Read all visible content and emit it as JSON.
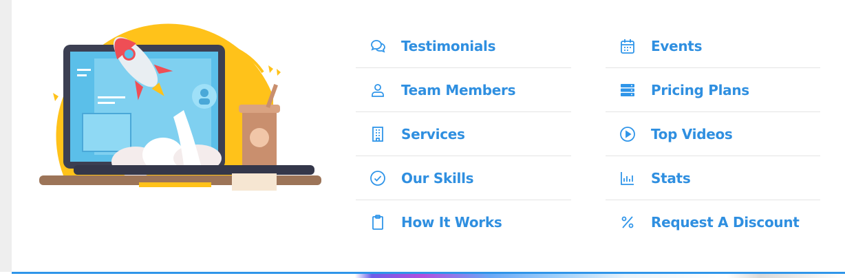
{
  "colors": {
    "accent": "#2f95e9",
    "label": "#2f8fe0",
    "divider": "#e4e4e4"
  },
  "illustration": {
    "name": "rocket-laptop-illustration"
  },
  "menu": {
    "column1": [
      {
        "label": "Testimonials",
        "icon": "chat-bubbles-icon"
      },
      {
        "label": "Team Members",
        "icon": "user-icon"
      },
      {
        "label": "Services",
        "icon": "building-icon"
      },
      {
        "label": "Our Skills",
        "icon": "check-circle-icon"
      },
      {
        "label": "How It Works",
        "icon": "clipboard-icon"
      }
    ],
    "column2": [
      {
        "label": "Events",
        "icon": "calendar-icon"
      },
      {
        "label": "Pricing Plans",
        "icon": "server-icon"
      },
      {
        "label": "Top Videos",
        "icon": "play-circle-icon"
      },
      {
        "label": "Stats",
        "icon": "bar-chart-icon"
      },
      {
        "label": "Request A Discount",
        "icon": "percent-icon"
      }
    ]
  }
}
